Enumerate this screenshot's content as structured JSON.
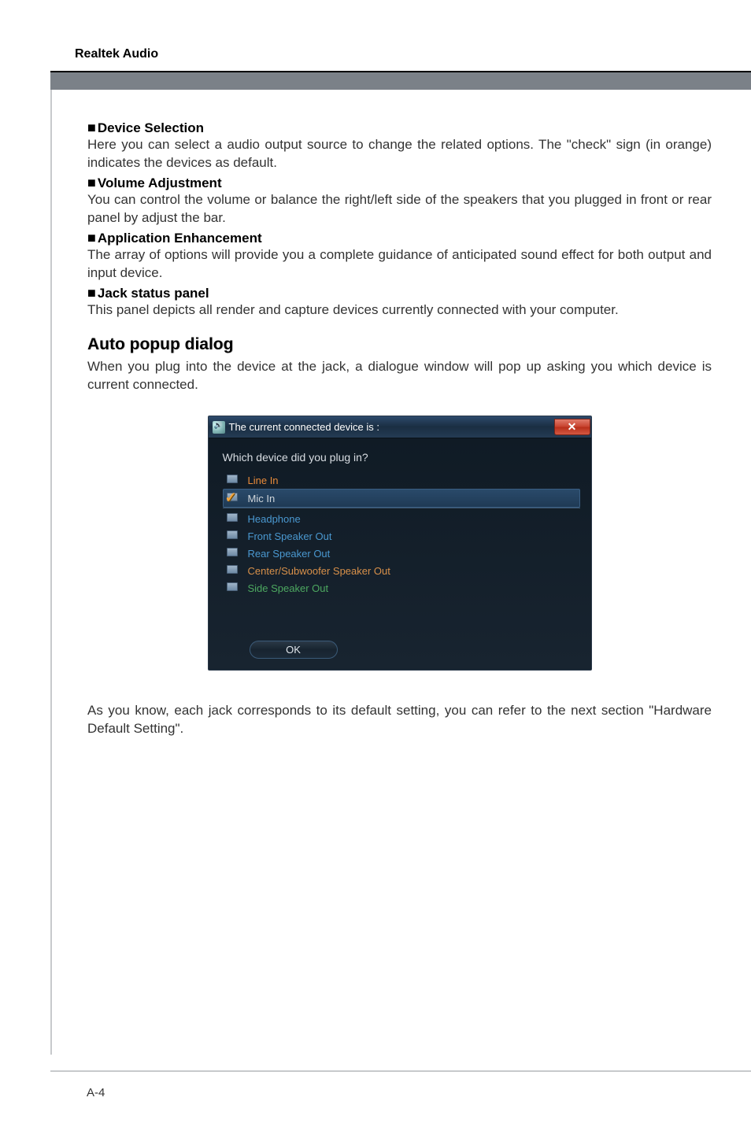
{
  "header": {
    "title": "Realtek Audio"
  },
  "sections": {
    "device_selection": {
      "heading": "Device Selection",
      "body": "Here you can select a audio output source to change the related options. The \"check\" sign (in orange) indicates the devices as default."
    },
    "volume_adjustment": {
      "heading": "Volume Adjustment",
      "body": "You can control the volume or balance the right/left side of the speakers that you plugged in front or rear panel by adjust the bar."
    },
    "application_enhancement": {
      "heading": "Application Enhancement",
      "body": "The array of options will provide you a complete guidance of anticipated sound effect for both output and input device."
    },
    "jack_status": {
      "heading": "Jack status panel",
      "body": "This panel depicts all render and capture devices currently connected with your computer."
    },
    "auto_popup": {
      "heading": "Auto popup dialog",
      "intro": "When you plug into the device at the jack, a dialogue window will pop up asking you which device is current connected.",
      "outro": "As you know, each jack corresponds to its default setting, you can refer to the next section \"Hardware Default Setting\"."
    }
  },
  "dialog": {
    "title": "The current connected device is :",
    "prompt": "Which device did you plug in?",
    "close": "✕",
    "devices": [
      {
        "label": "Line In",
        "cls": "linein",
        "selected": false
      },
      {
        "label": "Mic In",
        "cls": "micin",
        "selected": true
      },
      {
        "label": "Headphone",
        "cls": "front",
        "selected": false
      },
      {
        "label": "Front Speaker Out",
        "cls": "front",
        "selected": false
      },
      {
        "label": "Rear Speaker Out",
        "cls": "rear",
        "selected": false
      },
      {
        "label": "Center/Subwoofer Speaker Out",
        "cls": "center",
        "selected": false
      },
      {
        "label": "Side Speaker Out",
        "cls": "side",
        "selected": false
      }
    ],
    "ok": "OK"
  },
  "footer": {
    "page": "A-4"
  }
}
